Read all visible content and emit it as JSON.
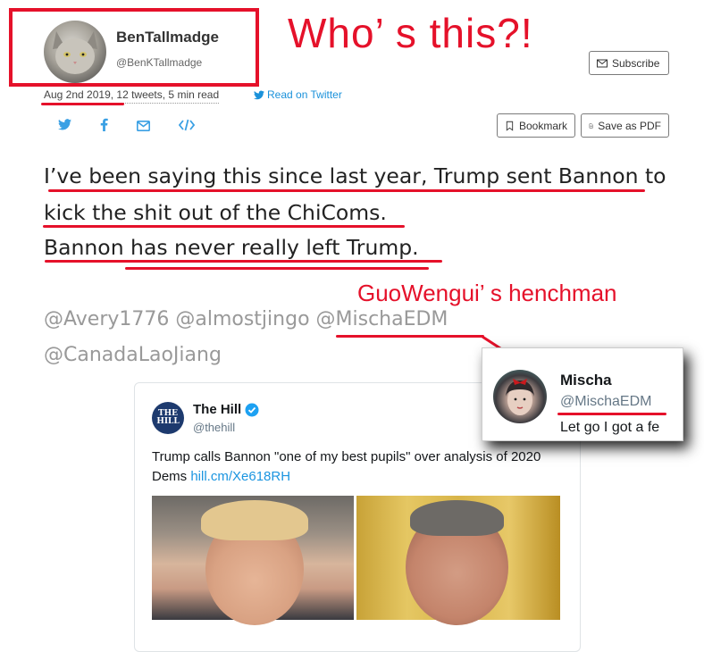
{
  "author": {
    "name": "BenTallmadge",
    "handle": "@BenKTallmadge"
  },
  "annotations": {
    "who": "Who’ s this?!",
    "henchman": "GuoWengui’ s henchman",
    "color": "#e5112a"
  },
  "meta": {
    "info": "Aug 2nd 2019, 12 tweets, 5 min read",
    "read_on": "Read on Twitter"
  },
  "buttons": {
    "subscribe": "Subscribe",
    "bookmark": "Bookmark",
    "save_pdf": "Save as PDF"
  },
  "share_icons": [
    "twitter-icon",
    "facebook-icon",
    "email-icon",
    "embed-icon"
  ],
  "thread": {
    "lines": [
      "I’ve been saying this since last year, Trump sent Bannon to",
      "kick the shit out of the ChiComs.",
      "Bannon has never really left Trump."
    ],
    "mentions_line1": "@Avery1776 @almostjingo @MischaEDM",
    "mentions_line2": "@CanadaLaoJiang"
  },
  "embedded_tweet": {
    "name": "The Hill",
    "handle": "@thehill",
    "logo_text": "THE HILL",
    "text": "Trump calls Bannon \"one of my best pupils\" over analysis of 2020 Dems ",
    "link": "hill.cm/Xe618RH"
  },
  "popup": {
    "name": "Mischa",
    "handle": "@MischaEDM",
    "text": "Let go I got a fe"
  }
}
